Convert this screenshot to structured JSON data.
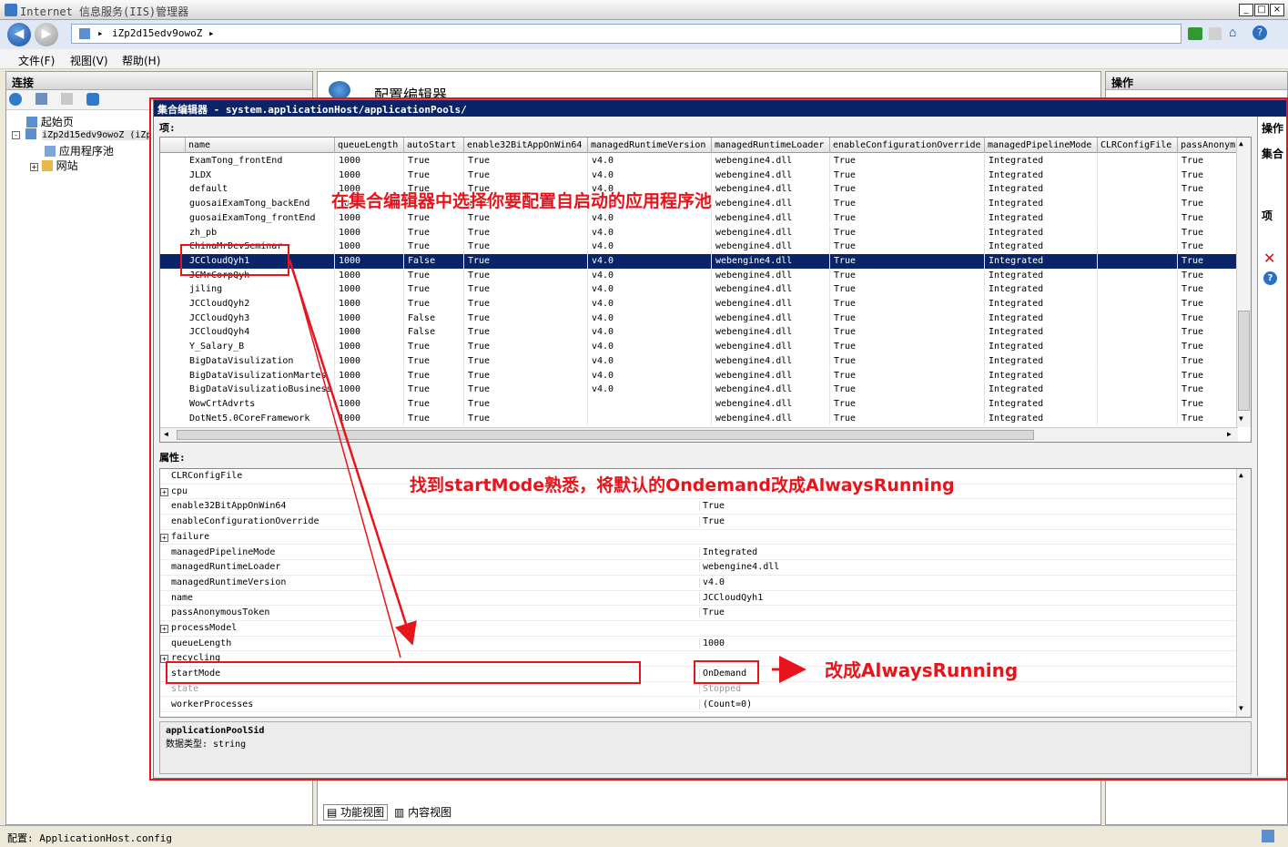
{
  "window": {
    "title": "Internet 信息服务(IIS)管理器"
  },
  "address": {
    "path": "iZp2d15edv9owoZ"
  },
  "menu": [
    "文件(F)",
    "视图(V)",
    "帮助(H)"
  ],
  "left_pane": {
    "header": "连接",
    "tree": [
      "起始页",
      "iZp2d15edv9owoZ (iZp",
      "应用程序池",
      "网站"
    ]
  },
  "middle_pane": {
    "title": "配置编辑器",
    "tab_feature": "功能视图",
    "tab_content": "内容视图"
  },
  "right_pane": {
    "header": "操作",
    "side_labels": [
      "操作",
      "集合",
      "项"
    ]
  },
  "dialog": {
    "title": "集合编辑器 - system.applicationHost/applicationPools/",
    "items_header": "项:",
    "props_header": "属性:",
    "columns": [
      "name",
      "queueLength",
      "autoStart",
      "enable32BitAppOnWin64",
      "managedRuntimeVersion",
      "managedRuntimeLoader",
      "enableConfigurationOverride",
      "managedPipelineMode",
      "CLRConfigFile",
      "passAnonymo"
    ],
    "rows": [
      [
        "ExamTong_frontEnd",
        "1000",
        "True",
        "True",
        "v4.0",
        "webengine4.dll",
        "True",
        "Integrated",
        "",
        "True"
      ],
      [
        "JLDX",
        "1000",
        "True",
        "True",
        "v4.0",
        "webengine4.dll",
        "True",
        "Integrated",
        "",
        "True"
      ],
      [
        "default",
        "1000",
        "True",
        "True",
        "v4.0",
        "webengine4.dll",
        "True",
        "Integrated",
        "",
        "True"
      ],
      [
        "guosaiExamTong_backEnd",
        "1000",
        "True",
        "True",
        "v4.0",
        "webengine4.dll",
        "True",
        "Integrated",
        "",
        "True"
      ],
      [
        "guosaiExamTong_frontEnd",
        "1000",
        "True",
        "True",
        "v4.0",
        "webengine4.dll",
        "True",
        "Integrated",
        "",
        "True"
      ],
      [
        "zh_pb",
        "1000",
        "True",
        "True",
        "v4.0",
        "webengine4.dll",
        "True",
        "Integrated",
        "",
        "True"
      ],
      [
        "ChinaMrDevSeminar",
        "1000",
        "True",
        "True",
        "v4.0",
        "webengine4.dll",
        "True",
        "Integrated",
        "",
        "True"
      ],
      [
        "JCCloudQyh1",
        "1000",
        "False",
        "True",
        "v4.0",
        "webengine4.dll",
        "True",
        "Integrated",
        "",
        "True"
      ],
      [
        "JCMrCorpQyh",
        "1000",
        "True",
        "True",
        "v4.0",
        "webengine4.dll",
        "True",
        "Integrated",
        "",
        "True"
      ],
      [
        "jiling",
        "1000",
        "True",
        "True",
        "v4.0",
        "webengine4.dll",
        "True",
        "Integrated",
        "",
        "True"
      ],
      [
        "JCCloudQyh2",
        "1000",
        "True",
        "True",
        "v4.0",
        "webengine4.dll",
        "True",
        "Integrated",
        "",
        "True"
      ],
      [
        "JCCloudQyh3",
        "1000",
        "False",
        "True",
        "v4.0",
        "webengine4.dll",
        "True",
        "Integrated",
        "",
        "True"
      ],
      [
        "JCCloudQyh4",
        "1000",
        "False",
        "True",
        "v4.0",
        "webengine4.dll",
        "True",
        "Integrated",
        "",
        "True"
      ],
      [
        "Y_Salary_B",
        "1000",
        "True",
        "True",
        "v4.0",
        "webengine4.dll",
        "True",
        "Integrated",
        "",
        "True"
      ],
      [
        "BigDataVisulization",
        "1000",
        "True",
        "True",
        "v4.0",
        "webengine4.dll",
        "True",
        "Integrated",
        "",
        "True"
      ],
      [
        "BigDataVisulizationMartes",
        "1000",
        "True",
        "True",
        "v4.0",
        "webengine4.dll",
        "True",
        "Integrated",
        "",
        "True"
      ],
      [
        "BigDataVisulizatioBusiness",
        "1000",
        "True",
        "True",
        "v4.0",
        "webengine4.dll",
        "True",
        "Integrated",
        "",
        "True"
      ],
      [
        "WowCrtAdvrts",
        "1000",
        "True",
        "True",
        "",
        "webengine4.dll",
        "True",
        "Integrated",
        "",
        "True"
      ],
      [
        "DotNet5.0CoreFramework",
        "1000",
        "True",
        "True",
        "",
        "webengine4.dll",
        "True",
        "Integrated",
        "",
        "True"
      ]
    ],
    "properties": [
      {
        "name": "CLRConfigFile",
        "value": "",
        "expand": false
      },
      {
        "name": "cpu",
        "value": "",
        "expand": true
      },
      {
        "name": "enable32BitAppOnWin64",
        "value": "True",
        "expand": false
      },
      {
        "name": "enableConfigurationOverride",
        "value": "True",
        "expand": false
      },
      {
        "name": "failure",
        "value": "",
        "expand": true
      },
      {
        "name": "managedPipelineMode",
        "value": "Integrated",
        "expand": false
      },
      {
        "name": "managedRuntimeLoader",
        "value": "webengine4.dll",
        "expand": false
      },
      {
        "name": "managedRuntimeVersion",
        "value": "v4.0",
        "expand": false
      },
      {
        "name": "name",
        "value": "JCCloudQyh1",
        "expand": false
      },
      {
        "name": "passAnonymousToken",
        "value": "True",
        "expand": false
      },
      {
        "name": "processModel",
        "value": "",
        "expand": true
      },
      {
        "name": "queueLength",
        "value": "1000",
        "expand": false
      },
      {
        "name": "recycling",
        "value": "",
        "expand": true
      },
      {
        "name": "startMode",
        "value": "OnDemand",
        "expand": false
      },
      {
        "name": "state",
        "value": "Stopped",
        "expand": false
      },
      {
        "name": "workerProcesses",
        "value": "(Count=0)",
        "expand": false
      }
    ],
    "desc_title": "applicationPoolSid",
    "desc_type": "数据类型: string"
  },
  "annotations": {
    "a1": "在集合编辑器中选择你要配置自启动的应用程序池",
    "a2": "找到startMode熟悉，将默认的Ondemand改成AlwaysRunning",
    "a3": "改成AlwaysRunning"
  },
  "status": {
    "text": "配置: ApplicationHost.config"
  },
  "colors": {
    "selection": "#0a246a",
    "annotation": "#e8141c"
  }
}
